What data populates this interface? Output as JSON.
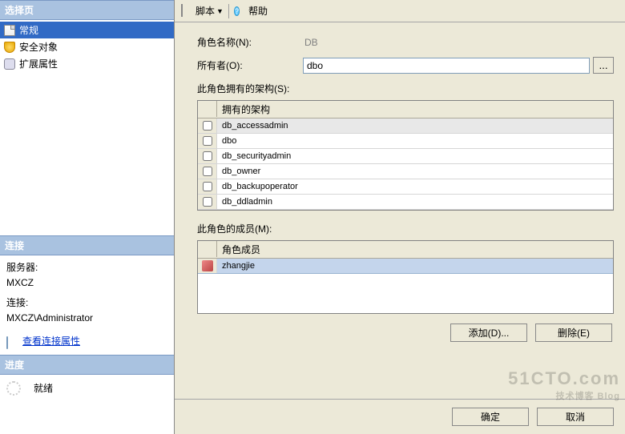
{
  "sidebar": {
    "pages_header": "选择页",
    "items": [
      {
        "label": "常规",
        "selected": true
      },
      {
        "label": "安全对象",
        "selected": false
      },
      {
        "label": "扩展属性",
        "selected": false
      }
    ],
    "conn_header": "连接",
    "server_label": "服务器:",
    "server_value": "MXCZ",
    "conn_label": "连接:",
    "conn_value": "MXCZ\\Administrator",
    "view_props": "查看连接属性",
    "progress_header": "进度",
    "progress_status": "就绪"
  },
  "toolbar": {
    "script": "脚本",
    "help": "帮助"
  },
  "form": {
    "role_name_label": "角色名称(N):",
    "role_name_value": "DB",
    "owner_label": "所有者(O):",
    "owner_value": "dbo",
    "browse": "..."
  },
  "schemas": {
    "label": "此角色拥有的架构(S):",
    "col_header": "拥有的架构",
    "rows": [
      {
        "name": "db_accessadmin",
        "checked": false,
        "selected": true
      },
      {
        "name": "dbo",
        "checked": false,
        "selected": false
      },
      {
        "name": "db_securityadmin",
        "checked": false,
        "selected": false
      },
      {
        "name": "db_owner",
        "checked": false,
        "selected": false
      },
      {
        "name": "db_backupoperator",
        "checked": false,
        "selected": false
      },
      {
        "name": "db_ddladmin",
        "checked": false,
        "selected": false
      }
    ]
  },
  "members": {
    "label": "此角色的成员(M):",
    "col_header": "角色成员",
    "rows": [
      {
        "name": "zhangjie"
      }
    ]
  },
  "buttons": {
    "add": "添加(D)...",
    "remove": "删除(E)",
    "ok": "确定",
    "cancel": "取消"
  },
  "watermark": {
    "main": "51CTO.com",
    "sub": "技术博客 Blog"
  }
}
